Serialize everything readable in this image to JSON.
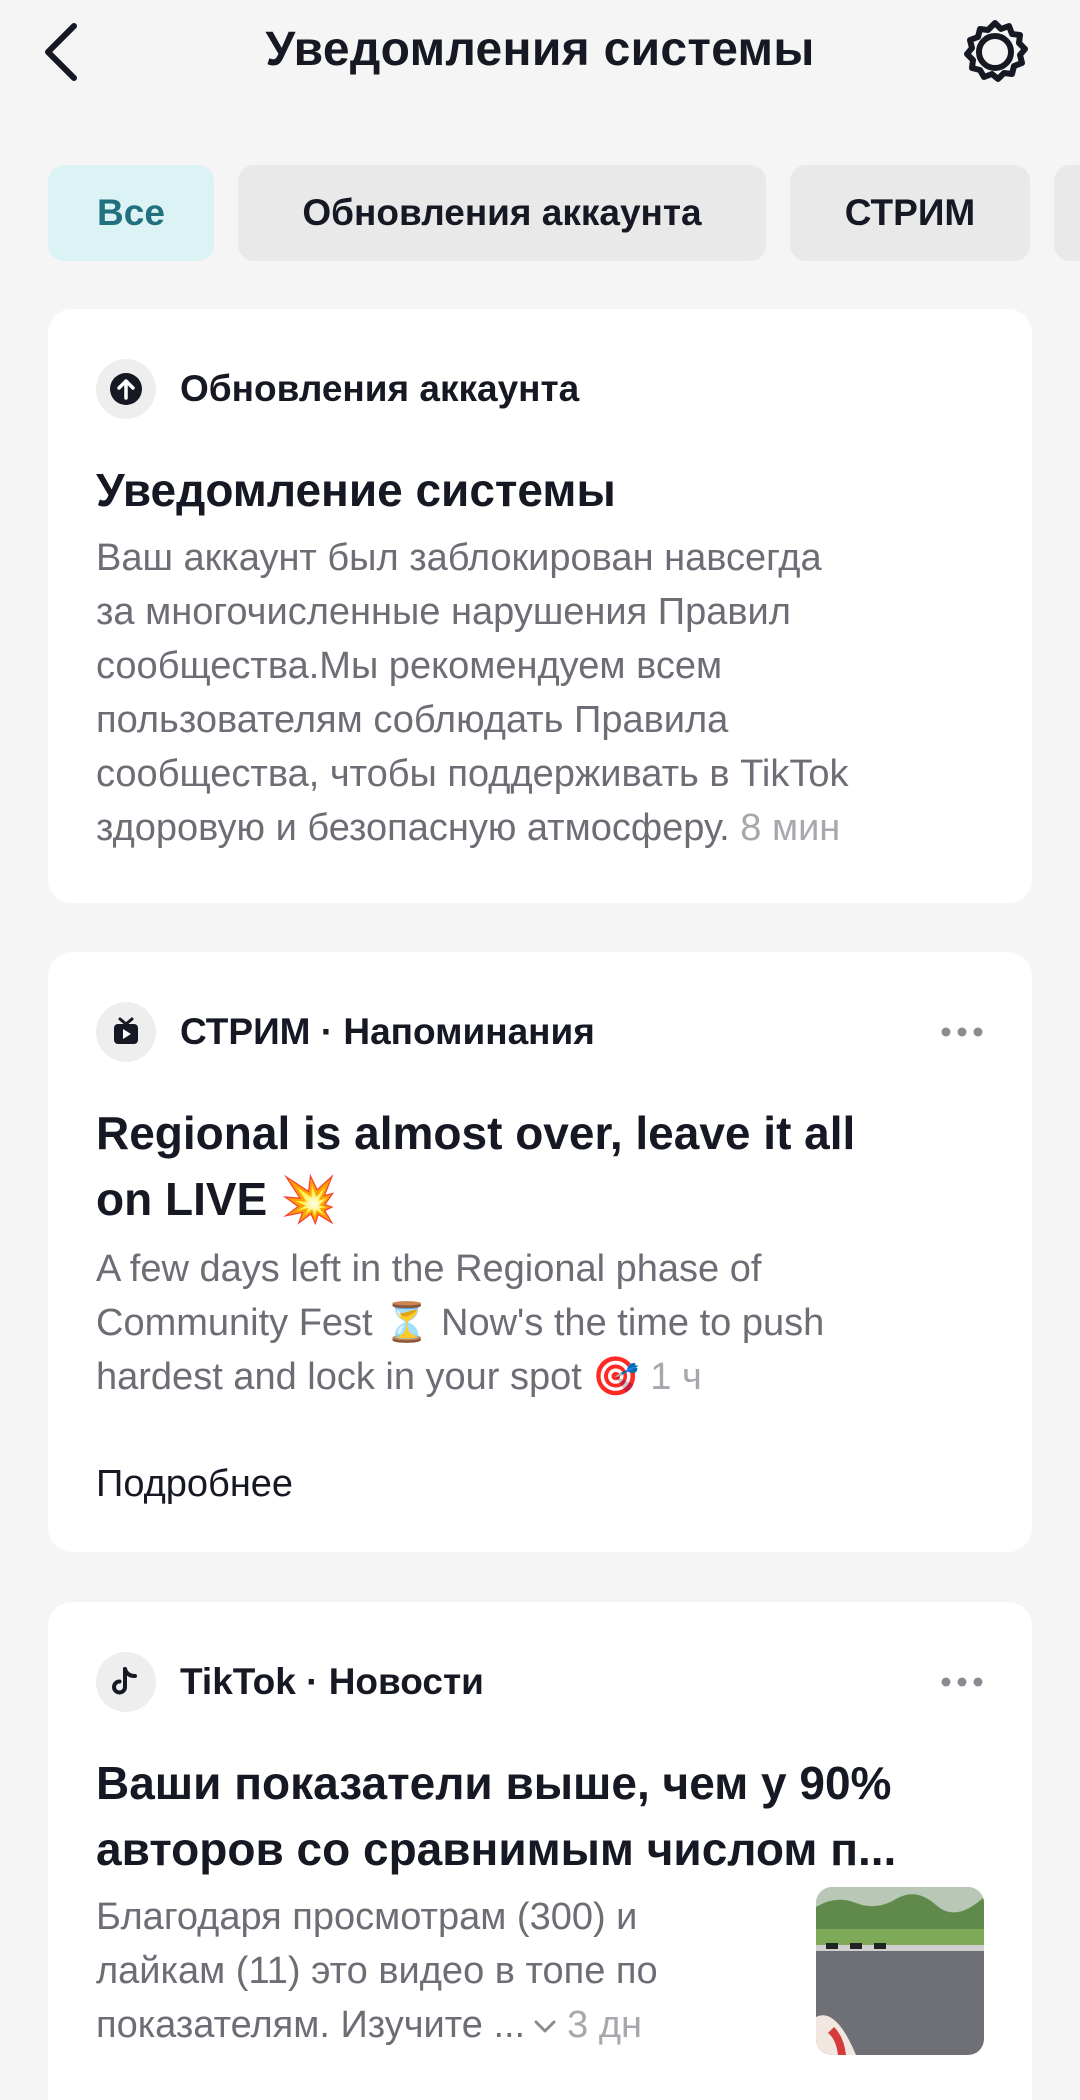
{
  "header": {
    "title": "Уведомления системы",
    "back_icon": "chevron-left-icon",
    "settings_icon": "gear-icon"
  },
  "tabs": [
    {
      "label": "Все",
      "active": true
    },
    {
      "label": "Обновления аккаунта",
      "active": false
    },
    {
      "label": "СТРИМ",
      "active": false
    }
  ],
  "notifications": [
    {
      "category": "Обновления аккаунта",
      "icon": "arrow-up-circle-icon",
      "title": "Уведомление системы",
      "body_lines": [
        "Ваш аккаунт был заблокирован навсегда",
        "за многочисленные нарушения Правил",
        "сообщества.Мы рекомендуем всем",
        "пользователям соблюдать Правила",
        "сообщества, чтобы поддерживать в TikTok",
        "здоровую и безопасную атмосферу."
      ],
      "time": "8 мин"
    },
    {
      "category": "СТРИМ · Напоминания",
      "icon": "live-tv-icon",
      "menu_icon": "more-horizontal-icon",
      "title_lines": [
        "Regional is almost over, leave it all",
        "on LIVE 💥"
      ],
      "body_lines": [
        "A few days left in the Regional phase of",
        "Community Fest ⏳ Now's the time to push",
        "hardest and lock in your spot 🎯"
      ],
      "time": "1 ч",
      "link": "Подробнее"
    },
    {
      "category": "TikTok · Новости",
      "icon": "tiktok-note-icon",
      "menu_icon": "more-horizontal-icon",
      "title_lines": [
        "Ваши показатели выше, чем у 90%",
        "авторов со сравнимым числом п..."
      ],
      "body_lines": [
        "Благодаря просмотрам (300) и",
        "лайкам (11) это видео в топе по",
        "показателям. Изучите ..."
      ],
      "expand_icon": "chevron-down-icon",
      "time": "3 дн",
      "thumbnail": "video-thumbnail"
    }
  ]
}
